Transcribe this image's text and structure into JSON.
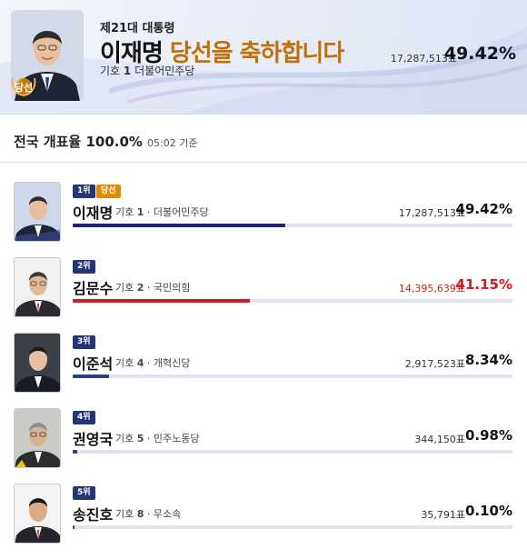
{
  "winner": {
    "election": "제21대 대통령",
    "name": "이재명",
    "congrats": "당선을 축하합니다",
    "badge": "당선",
    "number_label": "기호",
    "number": "1",
    "party": "더불어민주당",
    "votes": "17,287,513표",
    "percent": "49.42%"
  },
  "count": {
    "label": "전국 개표율 100.0%",
    "time": "05:02 기준"
  },
  "candidates": [
    {
      "rank": "1위",
      "elected": "당선",
      "name": "이재명",
      "number_label": "기호",
      "number": "1",
      "party": "· 더불어민주당",
      "votes": "17,287,513표",
      "percent": "49.42%",
      "share": 0.4942,
      "bar_color": "#1a2766"
    },
    {
      "rank": "2위",
      "name": "김문수",
      "number_label": "기호",
      "number": "2",
      "party": "· 국민의힘",
      "votes": "14,395,639표",
      "percent": "41.15%",
      "share": 0.4115,
      "bar_color": "#d61a1a"
    },
    {
      "rank": "3위",
      "name": "이준석",
      "number_label": "기호",
      "number": "4",
      "party": "· 개혁신당",
      "votes": "2,917,523표",
      "percent": "8.34%",
      "share": 0.0834,
      "bar_color": "#2b3f86"
    },
    {
      "rank": "4위",
      "name": "권영국",
      "number_label": "기호",
      "number": "5",
      "party": "· 민주노동당",
      "votes": "344,150표",
      "percent": "0.98%",
      "share": 0.0098,
      "bar_color": "#2b3f86"
    },
    {
      "rank": "5위",
      "name": "송진호",
      "number_label": "기호",
      "number": "8",
      "party": "· 무소속",
      "votes": "35,791표",
      "percent": "0.10%",
      "share": 0.001,
      "bar_color": "#2b3f86"
    }
  ],
  "colors": {
    "accent_navy": "#253676",
    "congrats_orange": "#c07008",
    "elected_orange": "#e08a00",
    "runner_up_red": "#d61a1a"
  }
}
